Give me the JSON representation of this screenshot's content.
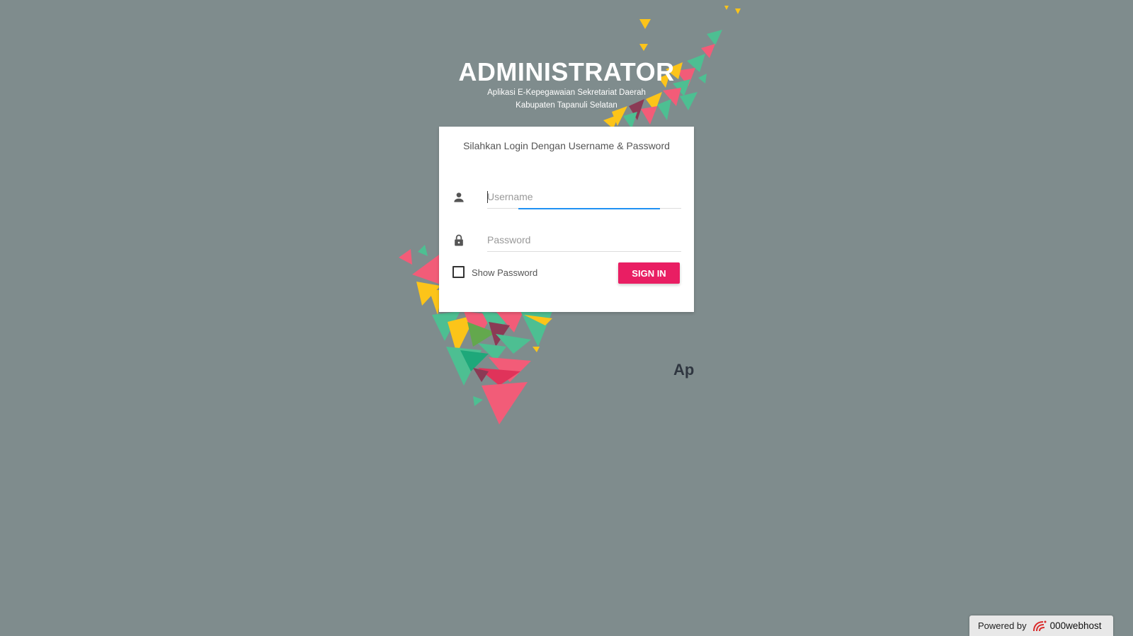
{
  "header": {
    "title": "ADMINISTRATOR",
    "subtitle_line1": "Aplikasi E-Kepegawaian Sekretariat Daerah",
    "subtitle_line2": "Kabupaten Tapanuli Selatan"
  },
  "login": {
    "message": "Silahkan Login Dengan Username & Password",
    "username_placeholder": "Username",
    "username_value": "",
    "password_placeholder": "Password",
    "password_value": "",
    "show_password_label": "Show Password",
    "show_password_checked": false,
    "signin_label": "SIGN IN",
    "username_icon": "person-icon",
    "password_icon": "lock-icon"
  },
  "background_text": "Ap",
  "footer": {
    "powered_label": "Powered by",
    "brand": "000webhost",
    "brand_icon": "000webhost-logo-icon"
  },
  "colors": {
    "background": "#7f8c8d",
    "primary_button": "#e91e63",
    "active_underline": "#1f91f3",
    "confetti_pink": "#f25c78",
    "confetti_green": "#4dbf92",
    "confetti_yellow": "#fcc419"
  }
}
